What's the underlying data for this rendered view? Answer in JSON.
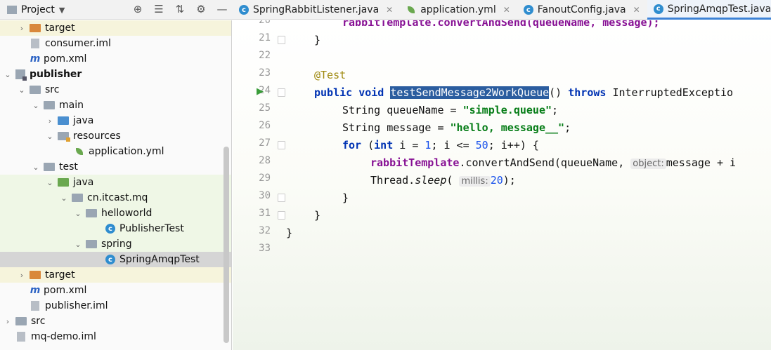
{
  "project_panel": {
    "title": "Project",
    "tools": [
      "target-icon",
      "collapse-icon",
      "expand-icon",
      "gear-icon",
      "minimize-icon"
    ]
  },
  "tabs": [
    {
      "label": "SpringRabbitListener.java",
      "icon": "class-icon"
    },
    {
      "label": "application.yml",
      "icon": "spring-leaf-icon"
    },
    {
      "label": "FanoutConfig.java",
      "icon": "class-icon"
    },
    {
      "label": "SpringAmqpTest.java",
      "icon": "class-icon",
      "active": true
    }
  ],
  "tree": [
    {
      "label": "target",
      "arrow": "›",
      "icon": "folder-orange"
    },
    {
      "label": "consumer.iml",
      "icon": "iml"
    },
    {
      "label": "pom.xml",
      "icon": "maven"
    },
    {
      "label": "publisher",
      "arrow": "⌄",
      "icon": "module"
    },
    {
      "label": "src",
      "arrow": "⌄",
      "icon": "folder"
    },
    {
      "label": "main",
      "arrow": "⌄",
      "icon": "folder"
    },
    {
      "label": "java",
      "arrow": "›",
      "icon": "folder-blue"
    },
    {
      "label": "resources",
      "arrow": "⌄",
      "icon": "folder-res"
    },
    {
      "label": "application.yml",
      "icon": "spring-leaf"
    },
    {
      "label": "test",
      "arrow": "⌄",
      "icon": "folder"
    },
    {
      "label": "java",
      "arrow": "⌄",
      "icon": "folder-green"
    },
    {
      "label": "cn.itcast.mq",
      "arrow": "⌄",
      "icon": "package"
    },
    {
      "label": "helloworld",
      "arrow": "⌄",
      "icon": "package"
    },
    {
      "label": "PublisherTest",
      "icon": "class"
    },
    {
      "label": "spring",
      "arrow": "⌄",
      "icon": "package"
    },
    {
      "label": "SpringAmqpTest",
      "icon": "class"
    },
    {
      "label": "target",
      "arrow": "›",
      "icon": "folder-orange"
    },
    {
      "label": "pom.xml",
      "icon": "maven"
    },
    {
      "label": "publisher.iml",
      "icon": "iml"
    },
    {
      "label": "src",
      "arrow": "›",
      "icon": "folder"
    },
    {
      "label": "mq-demo.iml",
      "icon": "iml"
    }
  ],
  "editor": {
    "line_numbers": [
      "20",
      "21",
      "22",
      "23",
      "24",
      "25",
      "26",
      "27",
      "28",
      "29",
      "30",
      "31",
      "32",
      "33"
    ],
    "code": {
      "l20": "rabbitTemplate.convertAndSend(queueName, message);",
      "l21": "}",
      "l23_ann": "@Test",
      "l24_public": "public",
      "l24_void": "void",
      "l24_method": "testSendMessage2WorkQueue",
      "l24_parens": "()",
      "l24_throws": "throws",
      "l24_exc": "InterruptedExceptio",
      "l25_type": "String queueName = ",
      "l25_str": "\"simple.queue\"",
      "l25_end": ";",
      "l26_type": "String message = ",
      "l26_str": "\"hello, message__\"",
      "l26_end": ";",
      "l27_for": "for",
      "l27_a": " (",
      "l27_int": "int",
      "l27_b": " i = ",
      "l27_one": "1",
      "l27_c": "; i <= ",
      "l27_fifty": "50",
      "l27_d": "; i++) {",
      "l28_field": "rabbitTemplate",
      "l28_call": ".convertAndSend(queueName, ",
      "l28_hint": "object:",
      "l28_rest": "message + i",
      "l29_cls": "Thread.",
      "l29_sleep": "sleep",
      "l29_paren": "(",
      "l29_hint": "millis:",
      "l29_num": "20",
      "l29_end": ");",
      "l30": "}",
      "l31": "}",
      "l32": "}"
    }
  }
}
